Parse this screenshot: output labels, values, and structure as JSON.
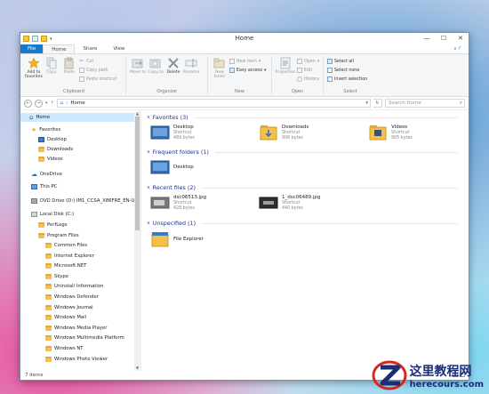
{
  "window": {
    "title": "Home"
  },
  "tabs": [
    {
      "label": "File"
    },
    {
      "label": "Home"
    },
    {
      "label": "Share"
    },
    {
      "label": "View"
    }
  ],
  "ribbon": {
    "clipboard": {
      "label": "Clipboard",
      "pin": "Add to favorites",
      "copy": "Copy",
      "paste": "Paste",
      "cut": "Cut",
      "copy_path": "Copy path",
      "paste_shortcut": "Paste shortcut"
    },
    "organize": {
      "label": "Organize",
      "move_to": "Move to",
      "copy_to": "Copy to",
      "delete": "Delete",
      "rename": "Rename"
    },
    "new": {
      "label": "New",
      "new_folder": "New folder",
      "new_item": "New item",
      "easy_access": "Easy access"
    },
    "open": {
      "label": "Open",
      "properties": "Properties",
      "open": "Open",
      "edit": "Edit",
      "history": "History"
    },
    "select": {
      "label": "Select",
      "select_all": "Select all",
      "select_none": "Select none",
      "invert": "Invert selection"
    }
  },
  "address": {
    "path": "Home",
    "search_placeholder": "Search Home"
  },
  "nav": {
    "home": "Home",
    "favorites": "Favorites",
    "desktop": "Desktop",
    "downloads": "Downloads",
    "videos": "Videos",
    "onedrive": "OneDrive",
    "thispc": "This PC",
    "dvd": "DVD Drive (D:) IM1_CCSA_X86FRE_EN-US",
    "localdisk": "Local Disk (C:)",
    "perflogs": "PerfLogs",
    "programfiles": "Program Files",
    "folders": [
      "Common Files",
      "Internet Explorer",
      "Microsoft.NET",
      "Skype",
      "Uninstall Information",
      "Windows Defender",
      "Windows Journal",
      "Windows Mail",
      "Windows Media Player",
      "Windows Multimedia Platform",
      "Windows NT",
      "Windows Photo Viewer"
    ]
  },
  "sections": {
    "favorites": "Favorites (3)",
    "frequent": "Frequent folders (1)",
    "recent": "Recent files (2)",
    "unspecified": "Unspecified (1)"
  },
  "favorites_items": [
    {
      "name": "Desktop",
      "type": "Shortcut",
      "size": "489 bytes"
    },
    {
      "name": "Downloads",
      "type": "Shortcut",
      "size": "906 bytes"
    },
    {
      "name": "Videos",
      "type": "Shortcut",
      "size": "905 bytes"
    }
  ],
  "frequent_items": [
    {
      "name": "Desktop"
    }
  ],
  "recent_items": [
    {
      "name": "dsc06513.jpg",
      "type": "Shortcut",
      "size": "428 bytes"
    },
    {
      "name": "1_dsc06489.jpg",
      "type": "Shortcut",
      "size": "440 bytes"
    }
  ],
  "unspecified_items": [
    {
      "name": "File Explorer"
    }
  ],
  "status": {
    "items": "7 items"
  },
  "watermark": {
    "cn": "这里教程网",
    "url": "herecours.com"
  }
}
